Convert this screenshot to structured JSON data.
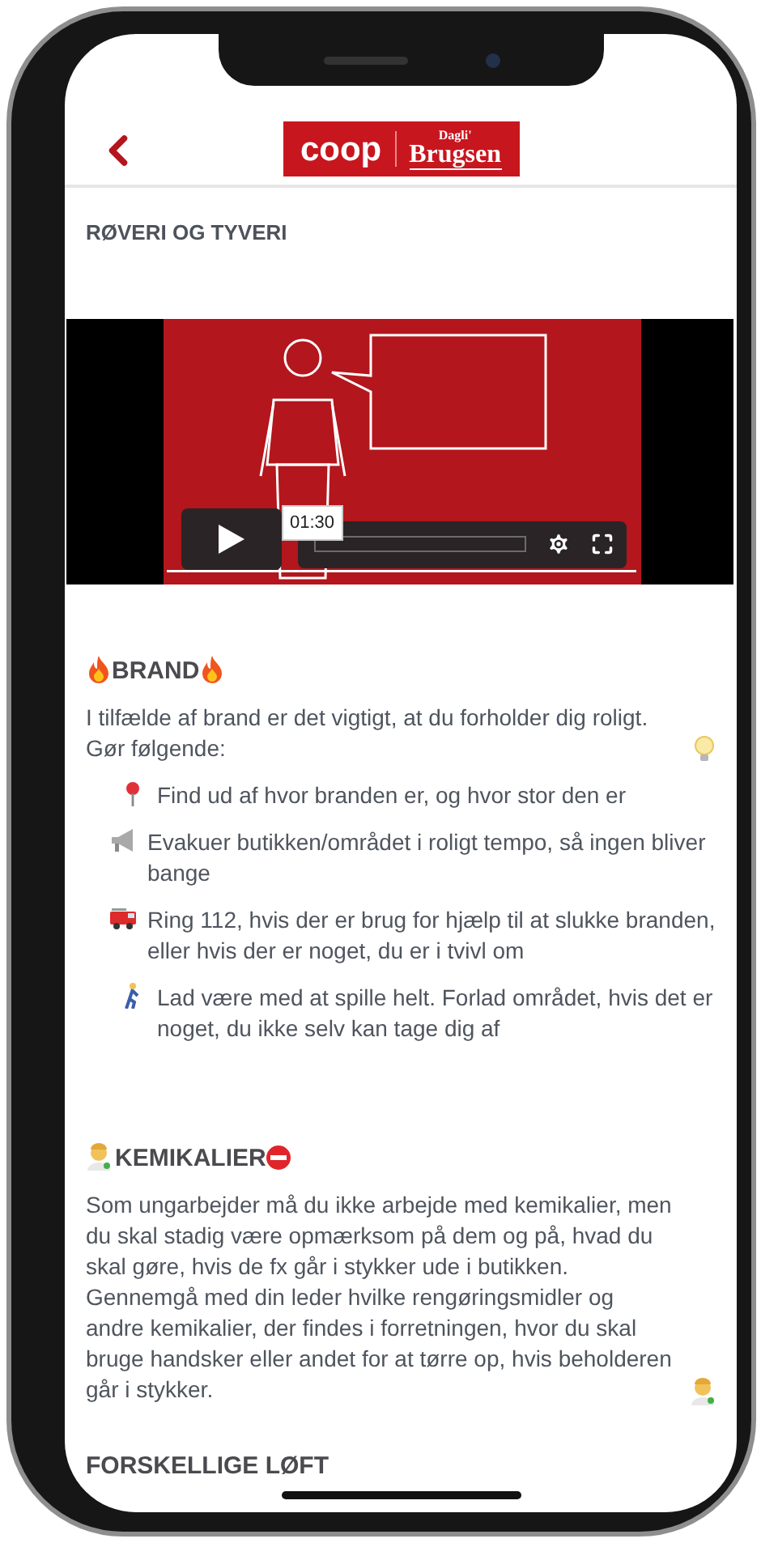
{
  "header": {
    "logo": {
      "brand": "coop",
      "store_top": "Dagli'",
      "store": "Brugsen"
    }
  },
  "page_title": "RØVERI OG TYVERI",
  "video": {
    "time": "01:30"
  },
  "sections": [
    {
      "kind": "fire",
      "heading": "BRAND",
      "intro": "I tilfælde af brand er det vigtigt, at du forholder dig roligt. Gør følgende:",
      "items": [
        {
          "kind": "pin",
          "text": "Find ud af hvor branden er, og hvor stor den er"
        },
        {
          "kind": "megaphone",
          "text": "Evakuer butikken/området i roligt tempo, så ingen bliver bange"
        },
        {
          "kind": "fire-engine",
          "text": "Ring 112, hvis der er brug for hjælp til at slukke branden, eller hvis der er noget, du er i tvivl om"
        },
        {
          "kind": "walker",
          "text": "Lad være med at spille helt. Forlad området, hvis det er noget, du ikke selv kan tage dig af"
        }
      ]
    },
    {
      "kind": "chemicals",
      "heading": "KEMIKALIER",
      "intro": "Som ungarbejder må du ikke arbejde med kemikalier, men du skal stadig være opmærksom på dem og på, hvad du skal gøre, hvis de fx går i stykker ude i butikken. Gennemgå med din leder hvilke rengøringsmidler og andre kemikalier, der findes i forretningen, hvor du skal bruge handsker eller andet for at tørre op, hvis beholderen går i stykker."
    },
    {
      "kind": "plain",
      "heading": "FORSKELLIGE LØFT"
    }
  ]
}
